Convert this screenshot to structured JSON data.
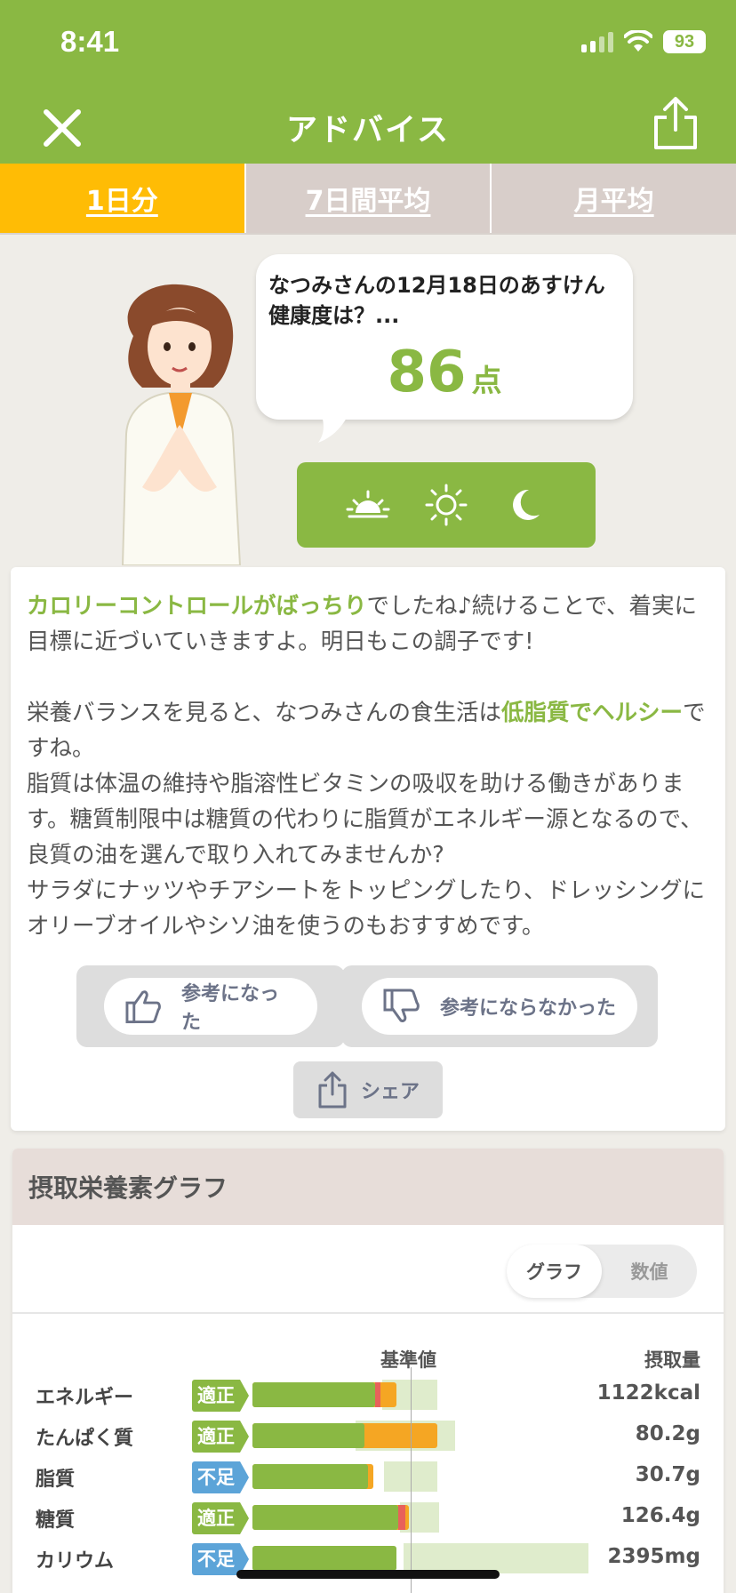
{
  "status_bar": {
    "time": "8:41",
    "battery": "93"
  },
  "nav": {
    "title": "アドバイス"
  },
  "tabs": [
    {
      "label": "1日分",
      "active": true
    },
    {
      "label": "7日間平均",
      "active": false
    },
    {
      "label": "月平均",
      "active": false
    }
  ],
  "bubble": {
    "text": "なつみさんの12月18日のあすけん健康度は？...",
    "score": "86",
    "unit": "点"
  },
  "meal_icons": [
    "sunrise-icon",
    "sun-icon",
    "moon-icon"
  ],
  "advice": {
    "p1_highlight": "カロリーコントロールがばっちり",
    "p1_rest": "でしたね♪続けることで、着実に目標に近づいていきますよ。明日もこの調子です!",
    "p2_pre": "栄養バランスを見ると、なつみさんの食生活は",
    "p2_highlight": "低脂質でヘルシー",
    "p2_post": "ですね。",
    "p3": "脂質は体温の維持や脂溶性ビタミンの吸収を助ける働きがあります。糖質制限中は糖質の代わりに脂質がエネルギー源となるので、良質の油を選んで取り入れてみませんか?",
    "p4": "サラダにナッツやチアシートをトッピングしたり、ドレッシングにオリーブオイルやシソ油を使うのもおすすめです。",
    "helpful_label": "参考になった",
    "not_helpful_label": "参考にならなかった",
    "share_label": "シェア"
  },
  "nutrients": {
    "title": "摂取栄養素グラフ",
    "toggle_graph": "グラフ",
    "toggle_values": "数値",
    "col_standard": "基準値",
    "col_intake": "摂取量",
    "colors": {
      "ok": "#8ab843",
      "low": "#5ca4d8",
      "over": "#f5a623"
    },
    "rows": [
      {
        "name": "エネルギー",
        "badge": "適正",
        "status": "ok",
        "value": "1122kcal"
      },
      {
        "name": "たんぱく質",
        "badge": "適正",
        "status": "ok",
        "value": "80.2g"
      },
      {
        "name": "脂質",
        "badge": "不足",
        "status": "low",
        "value": "30.7g"
      },
      {
        "name": "糖質",
        "badge": "適正",
        "status": "ok",
        "value": "126.4g"
      },
      {
        "name": "カリウム",
        "badge": "不足",
        "status": "low",
        "value": "2395mg"
      }
    ]
  }
}
